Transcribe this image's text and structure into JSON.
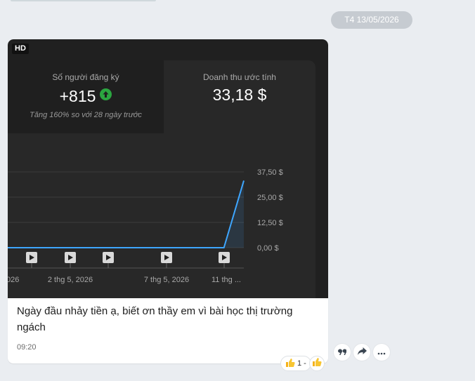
{
  "date_separator": "T4 13/05/2026",
  "message": {
    "media_badge": "HD",
    "caption": "Ngày đầu nhảy tiền ạ, biết ơn thầy em vì bài học thị trường ngách",
    "time": "09:20"
  },
  "analytics": {
    "subscribers": {
      "label": "Số người đăng ký",
      "value": "+815",
      "trend_icon": "arrow-up-circle-icon",
      "note": "Tăng 160% so với 28 ngày trước"
    },
    "revenue": {
      "label": "Doanh thu ước tính",
      "value": "33,18 $"
    }
  },
  "chart_data": {
    "type": "line",
    "x": [
      "~26",
      "2 thg 5, 2026",
      "",
      "7 thg 5, 2026",
      "11 thg ..."
    ],
    "x_tick_labels": [
      "026",
      "2 thg 5, 2026",
      "7 thg 5, 2026",
      "11 thg ..."
    ],
    "y_tick_labels": [
      "37,50 $",
      "25,00 $",
      "12,50 $",
      "0,00 $"
    ],
    "ylim": [
      0,
      37.5
    ],
    "series": [
      {
        "values": [
          0,
          0,
          0,
          0,
          0,
          0,
          0,
          0,
          0,
          0,
          0,
          0,
          33.18
        ]
      }
    ],
    "line_color": "#3ea6ff",
    "grid": true
  },
  "reactions": {
    "summary_icon": "thumbs-up-icon",
    "count": "1",
    "separator": "-",
    "react_icon": "thumbs-up-icon"
  },
  "actions": [
    "quote-icon",
    "forward-icon",
    "more-icon"
  ]
}
